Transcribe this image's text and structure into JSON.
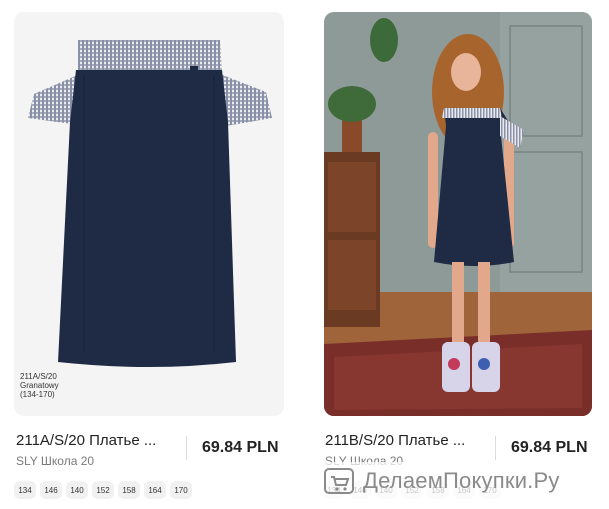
{
  "products": [
    {
      "title": "211A/S/20 Платье ...",
      "brand": "SLY Школа 20",
      "price": "69.84",
      "currency": "PLN",
      "tag_lines": [
        "211A/S/20",
        "Granatowy",
        "(134-170)"
      ],
      "sizes": [
        "134",
        "146",
        "140",
        "152",
        "158",
        "164",
        "170"
      ]
    },
    {
      "title": "211B/S/20 Платье ...",
      "brand": "SLY Школа 20",
      "price": "69.84",
      "currency": "PLN",
      "sizes": [
        "134",
        "146",
        "140",
        "152",
        "158",
        "164",
        "170"
      ]
    }
  ],
  "watermark": {
    "text": "ДелаемПокупки.Ру",
    "icon": "cart-icon"
  },
  "colors": {
    "navy": "#1f2a44",
    "gingham": "#b8bccb",
    "card_bg": "#f4f4f4",
    "wall": "#8e9a98"
  }
}
